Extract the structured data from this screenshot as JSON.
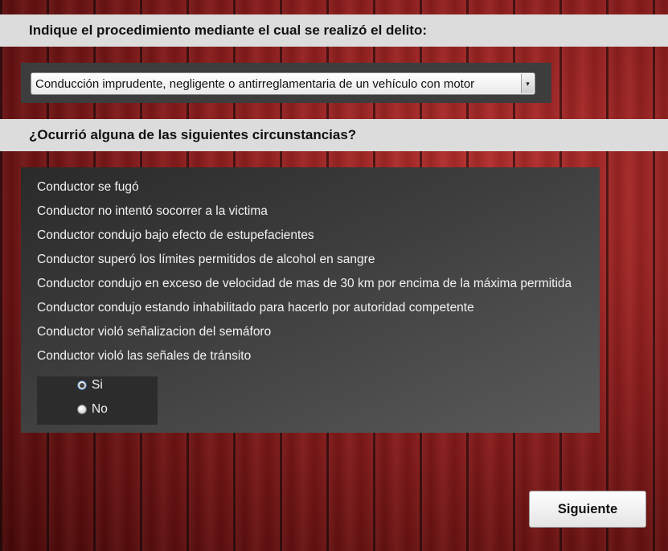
{
  "question1": {
    "label": "Indique el procedimiento mediante el cual se realizó el delito:",
    "selected_value": "Conducción imprudente, negligente o antirreglamentaria de un vehículo con motor",
    "dropdown_arrow": "▾"
  },
  "question2": {
    "label": "¿Ocurrió alguna de las siguientes circunstancias?",
    "items": [
      "Conductor se fugó",
      "Conductor no intentó socorrer a la victima",
      "Conductor condujo bajo efecto de estupefacientes",
      "Conductor superó los límites permitidos de alcohol en sangre",
      "Conductor condujo en exceso de velocidad de mas de 30 km por encima de la máxima permitida",
      "Conductor condujo estando inhabilitado para hacerlo por autoridad competente",
      "Conductor violó señalizacion del semáforo",
      "Conductor violó las señales de tránsito"
    ],
    "options": [
      {
        "label": "Si",
        "checked": true
      },
      {
        "label": "No",
        "checked": false
      }
    ]
  },
  "next_button": {
    "label": "Siguiente"
  },
  "colors": {
    "band": "#dcdcdc",
    "panel": "#3d3d3d",
    "background_wood": "#8c1c1c"
  }
}
